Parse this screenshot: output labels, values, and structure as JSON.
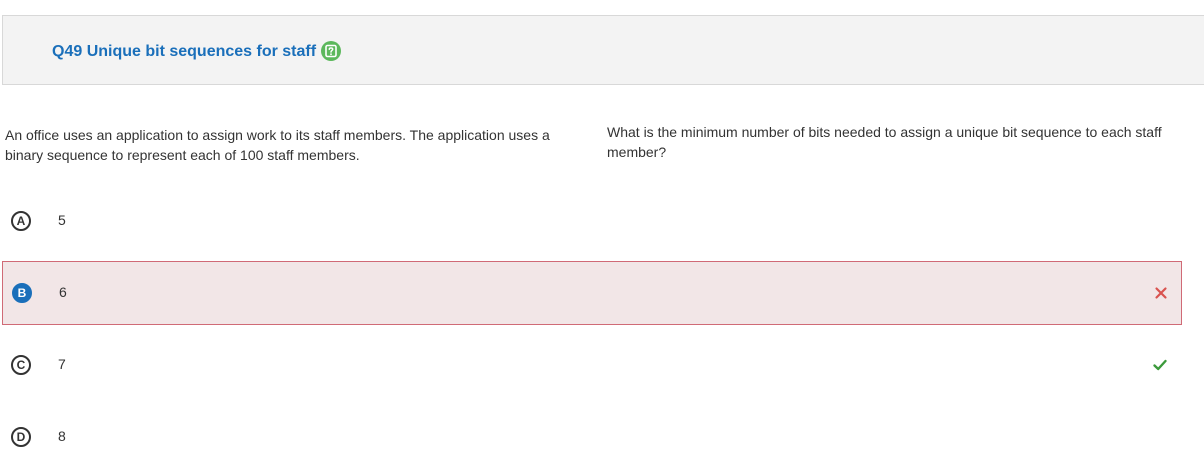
{
  "question": {
    "title": "Q49 Unique bit sequences for staff",
    "help_icon": "help-question-icon",
    "stem_left": "An office uses an application to assign work to its staff members. The application uses a binary sequence to represent each of 100 staff members.",
    "stem_right": "What is the minimum number of bits needed to assign a unique bit sequence to each staff member?"
  },
  "options": [
    {
      "letter": "A",
      "text": "5",
      "selected": false,
      "status": "none"
    },
    {
      "letter": "B",
      "text": "6",
      "selected": true,
      "status": "incorrect",
      "status_icon": "close-x-icon"
    },
    {
      "letter": "C",
      "text": "7",
      "selected": false,
      "status": "correct",
      "status_icon": "checkmark-icon"
    },
    {
      "letter": "D",
      "text": "8",
      "selected": false,
      "status": "none"
    }
  ],
  "colors": {
    "accent_blue": "#1a6fba",
    "help_green": "#5cb85c",
    "incorrect_red": "#d9534f",
    "incorrect_bg": "#f2e6e7",
    "correct_green": "#3c9a3c"
  }
}
